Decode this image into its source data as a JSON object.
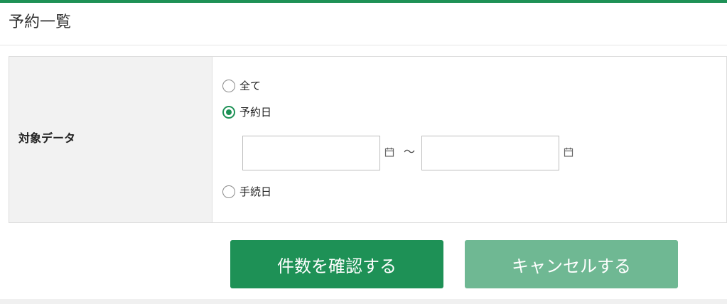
{
  "page": {
    "title": "予約一覧"
  },
  "filter": {
    "label": "対象データ",
    "options": [
      {
        "label": "全て",
        "checked": false
      },
      {
        "label": "予約日",
        "checked": true
      },
      {
        "label": "手続日",
        "checked": false
      }
    ],
    "date_from": {
      "value": "",
      "placeholder": ""
    },
    "date_to": {
      "value": "",
      "placeholder": ""
    },
    "range_separator": "～"
  },
  "actions": {
    "confirm_label": "件数を確認する",
    "cancel_label": "キャンセルする"
  },
  "colors": {
    "accent": "#1e9156",
    "accent_light": "#6fb893",
    "label_bg": "#f2f2f2"
  },
  "icons": {
    "date_picker": "calendar-icon"
  }
}
